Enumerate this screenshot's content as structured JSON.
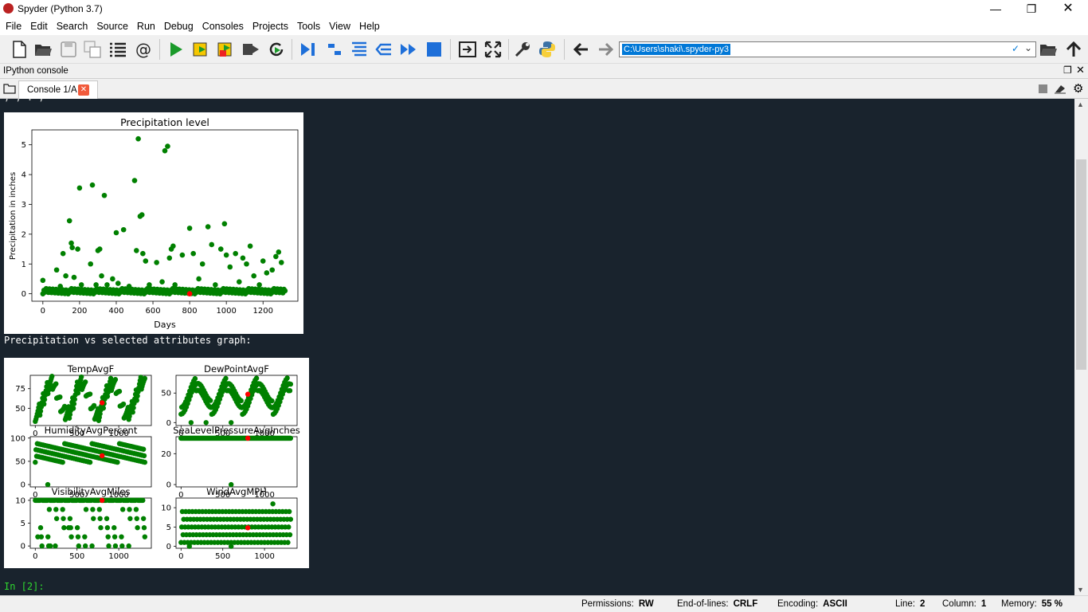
{
  "window": {
    "title": "Spyder (Python 3.7)"
  },
  "menu": [
    "File",
    "Edit",
    "Search",
    "Source",
    "Run",
    "Debug",
    "Consoles",
    "Projects",
    "Tools",
    "View",
    "Help"
  ],
  "toolbar": {
    "path": "C:\\Users\\shaki\\.spyder-py3"
  },
  "pane": {
    "title": "IPython console"
  },
  "tab": {
    "label": "Console 1/A"
  },
  "console": {
    "top_clip": "  ,  ,    .  ,",
    "section_text": "Precipitation vs selected attributes graph:",
    "prompt": "In [2]:"
  },
  "colors": {
    "point": "#008000",
    "highlight": "#ff0000",
    "console_bg": "#19232d",
    "prompt": "#2fd82f"
  },
  "chart_data": [
    {
      "type": "scatter",
      "title": "Precipitation level",
      "xlabel": "Days",
      "ylabel": "Precipitation in inches",
      "xlim": [
        -60,
        1390
      ],
      "ylim": [
        -0.25,
        5.5
      ],
      "xticks": [
        0,
        200,
        400,
        600,
        800,
        1000,
        1200
      ],
      "yticks": [
        0,
        1,
        2,
        3,
        4,
        5
      ],
      "series": [
        {
          "color": "#008000",
          "points": [
            [
              0,
              0.45
            ],
            [
              40,
              0.05
            ],
            [
              75,
              0.8
            ],
            [
              95,
              0.25
            ],
            [
              110,
              1.35
            ],
            [
              125,
              0.6
            ],
            [
              145,
              2.45
            ],
            [
              155,
              1.7
            ],
            [
              160,
              1.55
            ],
            [
              170,
              0.55
            ],
            [
              190,
              1.5
            ],
            [
              200,
              3.55
            ],
            [
              210,
              0.3
            ],
            [
              240,
              0.1
            ],
            [
              260,
              1.0
            ],
            [
              270,
              3.65
            ],
            [
              290,
              0.3
            ],
            [
              300,
              1.45
            ],
            [
              310,
              1.5
            ],
            [
              320,
              0.6
            ],
            [
              335,
              3.3
            ],
            [
              350,
              0.3
            ],
            [
              380,
              0.5
            ],
            [
              400,
              2.05
            ],
            [
              410,
              0.35
            ],
            [
              440,
              2.15
            ],
            [
              470,
              0.25
            ],
            [
              500,
              3.8
            ],
            [
              510,
              1.45
            ],
            [
              520,
              5.2
            ],
            [
              530,
              2.6
            ],
            [
              540,
              2.65
            ],
            [
              545,
              1.35
            ],
            [
              560,
              1.1
            ],
            [
              580,
              0.3
            ],
            [
              620,
              1.05
            ],
            [
              650,
              0.4
            ],
            [
              665,
              4.8
            ],
            [
              680,
              4.95
            ],
            [
              690,
              1.2
            ],
            [
              700,
              1.5
            ],
            [
              710,
              1.6
            ],
            [
              720,
              0.3
            ],
            [
              760,
              1.3
            ],
            [
              800,
              2.2
            ],
            [
              820,
              1.35
            ],
            [
              850,
              0.5
            ],
            [
              870,
              1.0
            ],
            [
              900,
              2.25
            ],
            [
              920,
              1.65
            ],
            [
              940,
              0.3
            ],
            [
              970,
              1.5
            ],
            [
              990,
              2.35
            ],
            [
              1000,
              1.3
            ],
            [
              1020,
              0.9
            ],
            [
              1050,
              1.35
            ],
            [
              1070,
              0.4
            ],
            [
              1090,
              1.2
            ],
            [
              1110,
              1.0
            ],
            [
              1130,
              1.6
            ],
            [
              1150,
              0.6
            ],
            [
              1180,
              0.3
            ],
            [
              1200,
              1.1
            ],
            [
              1220,
              0.7
            ],
            [
              1250,
              0.8
            ],
            [
              1270,
              1.25
            ],
            [
              1285,
              1.4
            ],
            [
              1300,
              1.05
            ],
            [
              1320,
              0.1
            ]
          ]
        },
        {
          "color": "#ff0000",
          "points": [
            [
              800,
              0.0
            ]
          ]
        }
      ]
    },
    {
      "type": "scatter",
      "title": "TempAvgF",
      "xlim": [
        -60,
        1390
      ],
      "ylim": [
        28,
        92
      ],
      "yticks": [
        50,
        75
      ],
      "xticks": [
        0,
        500,
        1000
      ],
      "highlight": [
        800,
        57
      ]
    },
    {
      "type": "scatter",
      "title": "DewPointAvgF",
      "xlim": [
        -60,
        1390
      ],
      "ylim": [
        -5,
        80
      ],
      "yticks": [
        0,
        50
      ],
      "xticks": [
        0,
        500,
        1000
      ],
      "highlight": [
        800,
        48
      ]
    },
    {
      "type": "scatter",
      "title": "HumidityAvgPercent",
      "xlim": [
        -60,
        1390
      ],
      "ylim": [
        -5,
        103
      ],
      "yticks": [
        0,
        50,
        100
      ],
      "xticks": [
        0,
        500,
        1000
      ],
      "highlight": [
        800,
        62
      ]
    },
    {
      "type": "scatter",
      "title": "SeaLevelPressureAvgInches",
      "xlim": [
        -60,
        1390
      ],
      "ylim": [
        -1.5,
        31
      ],
      "yticks": [
        0,
        20
      ],
      "xticks": [
        0,
        500,
        1000
      ],
      "highlight": [
        800,
        30
      ]
    },
    {
      "type": "scatter",
      "title": "VisibilityAvgMiles",
      "xlim": [
        -60,
        1390
      ],
      "ylim": [
        -0.5,
        10.5
      ],
      "yticks": [
        0,
        5,
        10
      ],
      "xticks": [
        0,
        500,
        1000
      ],
      "highlight": [
        800,
        10
      ]
    },
    {
      "type": "scatter",
      "title": "WindAvgMPH",
      "xlim": [
        -60,
        1390
      ],
      "ylim": [
        -0.5,
        12.5
      ],
      "yticks": [
        0,
        5,
        10
      ],
      "xticks": [
        0,
        500,
        1000
      ],
      "highlight": [
        800,
        4.8
      ]
    }
  ],
  "status": {
    "permissions_label": "Permissions:",
    "permissions": "RW",
    "eol_label": "End-of-lines:",
    "eol": "CRLF",
    "encoding_label": "Encoding:",
    "encoding": "ASCII",
    "line_label": "Line:",
    "line": "2",
    "column_label": "Column:",
    "column": "1",
    "memory_label": "Memory:",
    "memory": "55 %"
  }
}
